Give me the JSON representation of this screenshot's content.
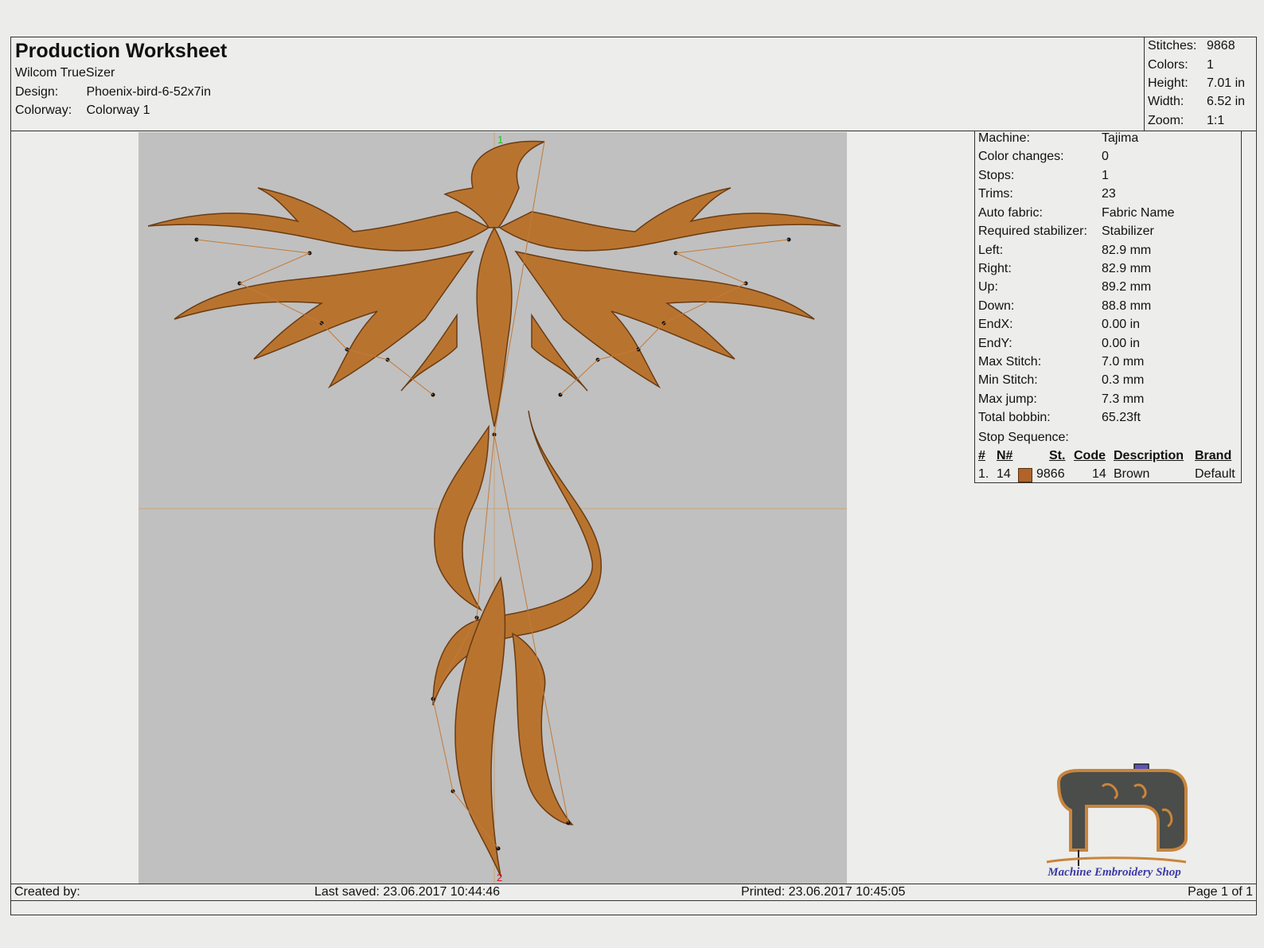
{
  "header": {
    "title": "Production Worksheet",
    "software": "Wilcom TrueSizer",
    "design_label": "Design:",
    "design_value": "Phoenix-bird-6-52x7in",
    "colorway_label": "Colorway:",
    "colorway_value": "Colorway 1"
  },
  "summary": [
    {
      "label": "Stitches:",
      "value": "9868"
    },
    {
      "label": "Colors:",
      "value": "1"
    },
    {
      "label": "Height:",
      "value": "7.01 in"
    },
    {
      "label": "Width:",
      "value": "6.52 in"
    },
    {
      "label": "Zoom:",
      "value": "1:1"
    }
  ],
  "stats": [
    {
      "label": "Machine:",
      "value": "Tajima"
    },
    {
      "label": "Color changes:",
      "value": "0"
    },
    {
      "label": "Stops:",
      "value": "1"
    },
    {
      "label": "Trims:",
      "value": "23"
    },
    {
      "label": "Auto fabric:",
      "value": "Fabric Name"
    },
    {
      "label": "Required stabilizer:",
      "value": "Stabilizer"
    },
    {
      "label": "Left:",
      "value": "82.9 mm"
    },
    {
      "label": "Right:",
      "value": "82.9 mm"
    },
    {
      "label": "Up:",
      "value": "89.2 mm"
    },
    {
      "label": "Down:",
      "value": "88.8 mm"
    },
    {
      "label": "EndX:",
      "value": "0.00 in"
    },
    {
      "label": "EndY:",
      "value": "0.00 in"
    },
    {
      "label": "Max Stitch:",
      "value": "7.0 mm"
    },
    {
      "label": "Min Stitch:",
      "value": "0.3 mm"
    },
    {
      "label": "Max jump:",
      "value": "7.3 mm"
    },
    {
      "label": "Total bobbin:",
      "value": "65.23ft"
    }
  ],
  "stop_sequence": {
    "label": "Stop Sequence:",
    "headers": {
      "num": "#",
      "needle": "N#",
      "stitches": "St.",
      "code": "Code",
      "description": "Description",
      "brand": "Brand"
    },
    "rows": [
      {
        "num": "1.",
        "needle": "14",
        "stitches": "9866",
        "code": "14",
        "description": "Brown",
        "brand": "Default",
        "color": "#b0642a"
      }
    ]
  },
  "canvas": {
    "start_marker": "1",
    "end_marker": "2",
    "thread_color": "#b8742f",
    "outline_color": "#6b3b12"
  },
  "footer": {
    "created_by": "Created by:",
    "last_saved": "Last saved: 23.06.2017 10:44:46",
    "printed": "Printed: 23.06.2017 10:45:05",
    "page": "Page 1 of 1"
  },
  "logo": {
    "text": "Machine Embroidery Shop"
  }
}
